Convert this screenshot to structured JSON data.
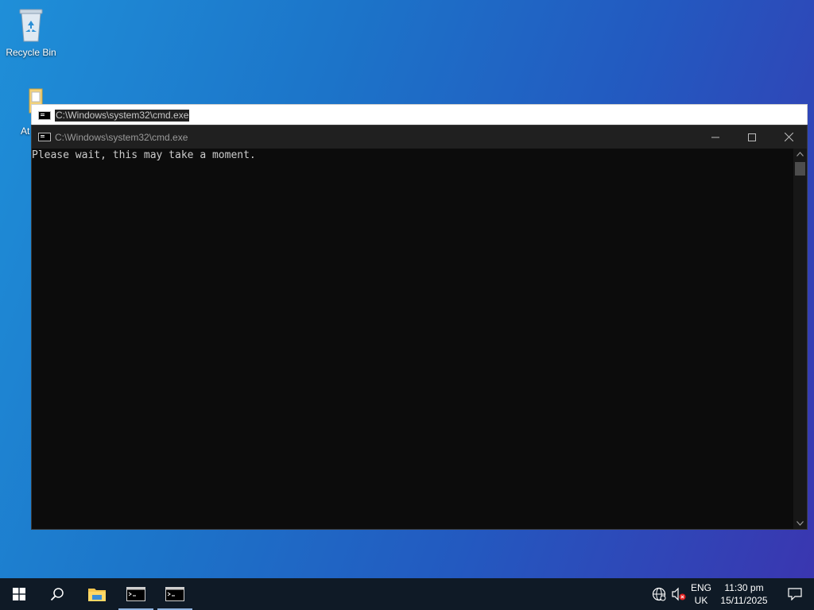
{
  "desktop": {
    "icons": [
      {
        "label": "Recycle Bin",
        "icon": "recycle-bin-icon"
      },
      {
        "label": "At",
        "icon": "folder-icon"
      }
    ]
  },
  "back_window": {
    "title": "C:\\Windows\\system32\\cmd.exe"
  },
  "cmd_window": {
    "title": "C:\\Windows\\system32\\cmd.exe",
    "console_text": "Please wait, this may take a moment.",
    "controls": {
      "minimize": "minimize-icon",
      "maximize": "maximize-icon",
      "close": "close-icon"
    }
  },
  "taskbar": {
    "items": [
      "start-icon",
      "search-icon",
      "file-explorer-icon",
      "cmd-window-1",
      "cmd-window-2"
    ],
    "tray": {
      "language_line1": "ENG",
      "language_line2": "UK",
      "time": "11:30 pm",
      "date": "15/11/2025"
    }
  },
  "colors": {
    "taskbar": "#0f1a26",
    "console_bg": "#0c0c0c",
    "titlebar": "#202020",
    "accent": "#8fb4e0"
  }
}
